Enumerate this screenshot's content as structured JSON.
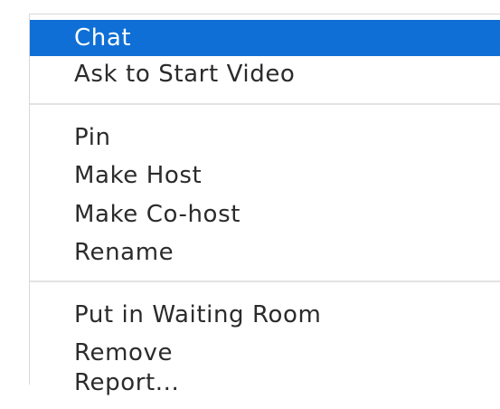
{
  "context_menu": {
    "items": [
      {
        "label": "Chat",
        "selected": true
      },
      {
        "label": "Ask to Start Video",
        "selected": false
      },
      {
        "label": "Pin",
        "selected": false
      },
      {
        "label": "Make Host",
        "selected": false
      },
      {
        "label": "Make Co-host",
        "selected": false
      },
      {
        "label": "Rename",
        "selected": false
      },
      {
        "label": "Put in Waiting Room",
        "selected": false
      },
      {
        "label": "Remove",
        "selected": false
      },
      {
        "label": "Report...",
        "selected": false
      }
    ],
    "colors": {
      "highlight": "#0f6fd6",
      "highlight_text": "#ffffff",
      "text": "#2b2b2b",
      "separator": "#e3e3e3"
    }
  }
}
